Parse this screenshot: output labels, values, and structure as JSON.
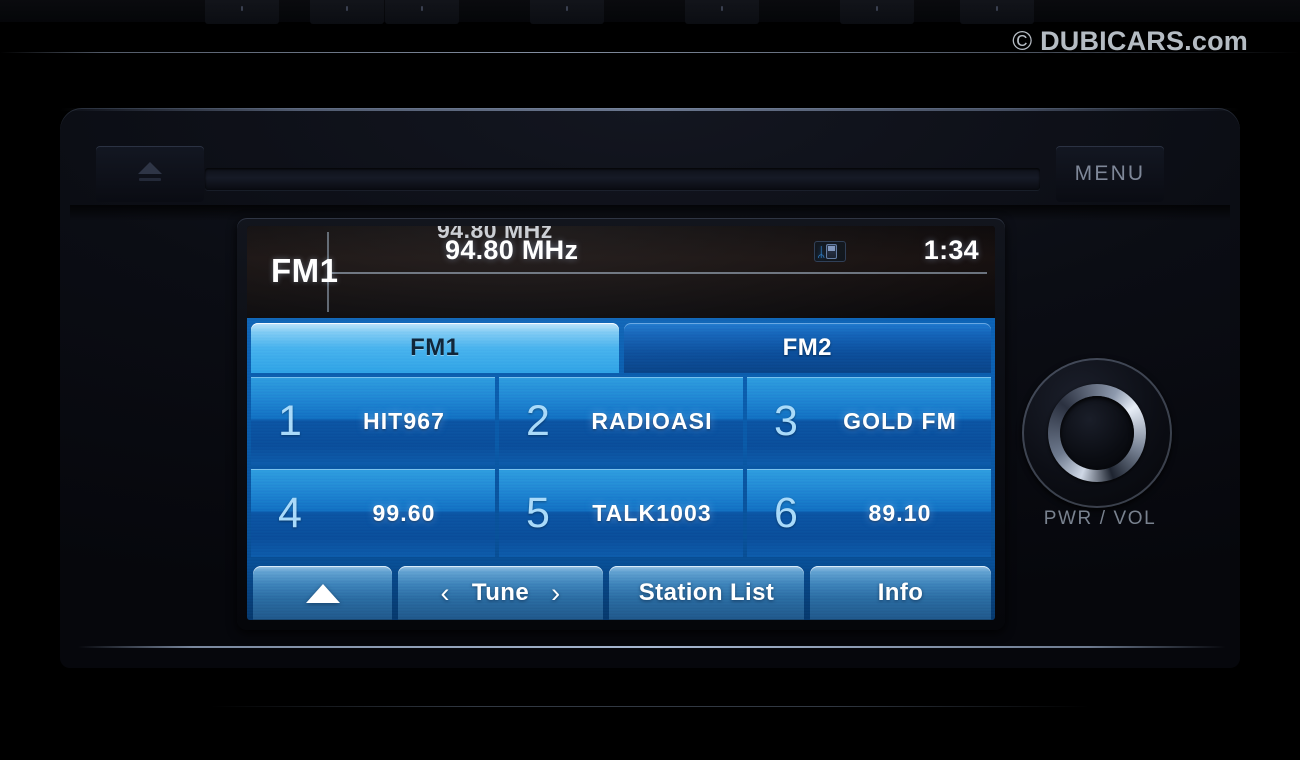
{
  "watermark": {
    "copyright": "©",
    "brand": "DUBICARS.com"
  },
  "unit": {
    "eject_label": "eject-button",
    "menu_label": "MENU",
    "knob_label": "PWR / VOL"
  },
  "screen": {
    "header": {
      "band": "FM1",
      "clipped_frequency": "94.80 MHz",
      "frequency": "94.80 MHz",
      "bluetooth_glyph": "ᛦ",
      "clock": "1:34"
    },
    "tabs": [
      {
        "label": "FM1",
        "active": true
      },
      {
        "label": "FM2",
        "active": false
      }
    ],
    "presets": [
      {
        "number": "1",
        "name": "HIT967"
      },
      {
        "number": "2",
        "name": "RADIOASI"
      },
      {
        "number": "3",
        "name": "GOLD FM"
      },
      {
        "number": "4",
        "name": "99.60"
      },
      {
        "number": "5",
        "name": "TALK1003"
      },
      {
        "number": "6",
        "name": "89.10"
      }
    ],
    "actions": {
      "scroll_up": "",
      "tune_prev": "‹",
      "tune_label": "Tune",
      "tune_next": "›",
      "station_list": "Station List",
      "info": "Info"
    }
  },
  "colors": {
    "accent_blue": "#1f85d2",
    "tab_active": "#46b2ee",
    "tab_inactive": "#0c4f9c",
    "preset_number": "#a9dbfa",
    "text_white": "#ffffff",
    "bluetooth": "#2f8fe8",
    "chrome": "#c3d7f5"
  }
}
